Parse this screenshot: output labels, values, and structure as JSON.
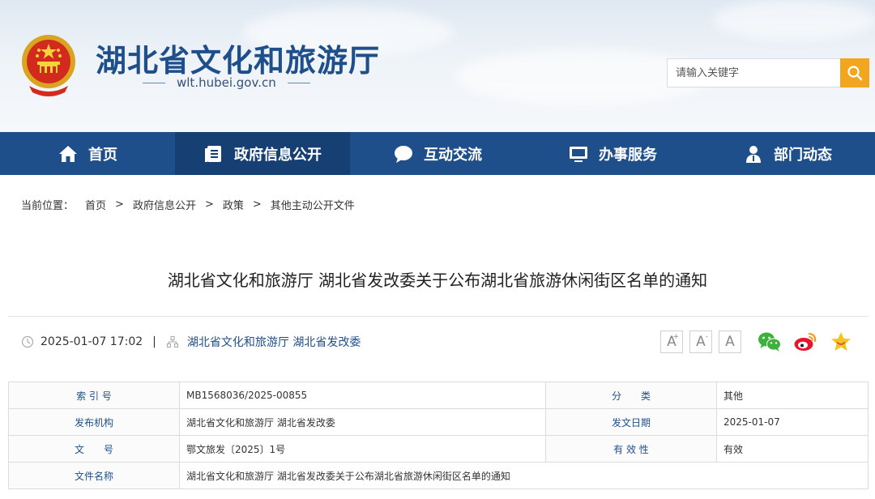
{
  "site": {
    "title": "湖北省文化和旅游厅",
    "domain": "wlt.hubei.gov.cn"
  },
  "search": {
    "placeholder": "请输入关键字",
    "icon": "search-icon",
    "button_color": "#f2a51f"
  },
  "nav": {
    "items": [
      {
        "label": "首页",
        "icon": "home-icon"
      },
      {
        "label": "政府信息公开",
        "icon": "document-icon",
        "active": true
      },
      {
        "label": "互动交流",
        "icon": "chat-bubble-icon"
      },
      {
        "label": "办事服务",
        "icon": "monitor-icon"
      },
      {
        "label": "部门动态",
        "icon": "person-icon"
      }
    ],
    "color": "#1f4f8a",
    "active_color": "#163f74"
  },
  "breadcrumb": {
    "prefix": "当前位置：",
    "sep": ">",
    "items": [
      "首页",
      "政府信息公开",
      "政策",
      "其他主动公开文件"
    ]
  },
  "article": {
    "title": "湖北省文化和旅游厅 湖北省发改委关于公布湖北省旅游休闲街区名单的通知",
    "datetime": "2025-01-07 17:02",
    "pipe": "|",
    "publisher": "湖北省文化和旅游厅 湖北省发改委"
  },
  "font_controls": {
    "increase": "A",
    "increase_mark": "+",
    "decrease": "A",
    "decrease_mark": "-",
    "reset": "A"
  },
  "share": [
    "wechat-icon",
    "weibo-icon",
    "favorite-star-icon"
  ],
  "info": {
    "index_label": "索 引 号",
    "index_value": "MB1568036/2025-00855",
    "category_label": "分　　类",
    "category_value": "其他",
    "issuer_label": "发布机构",
    "issuer_value": "湖北省文化和旅游厅 湖北省发改委",
    "date_label": "发文日期",
    "date_value": "2025-01-07",
    "docno_label": "文　　号",
    "docno_value": "鄂文旅发〔2025〕1号",
    "validity_label": "有 效 性",
    "validity_value": "有效",
    "name_label": "文件名称",
    "name_value": "湖北省文化和旅游厅 湖北省发改委关于公布湖北省旅游休闲街区名单的通知"
  }
}
